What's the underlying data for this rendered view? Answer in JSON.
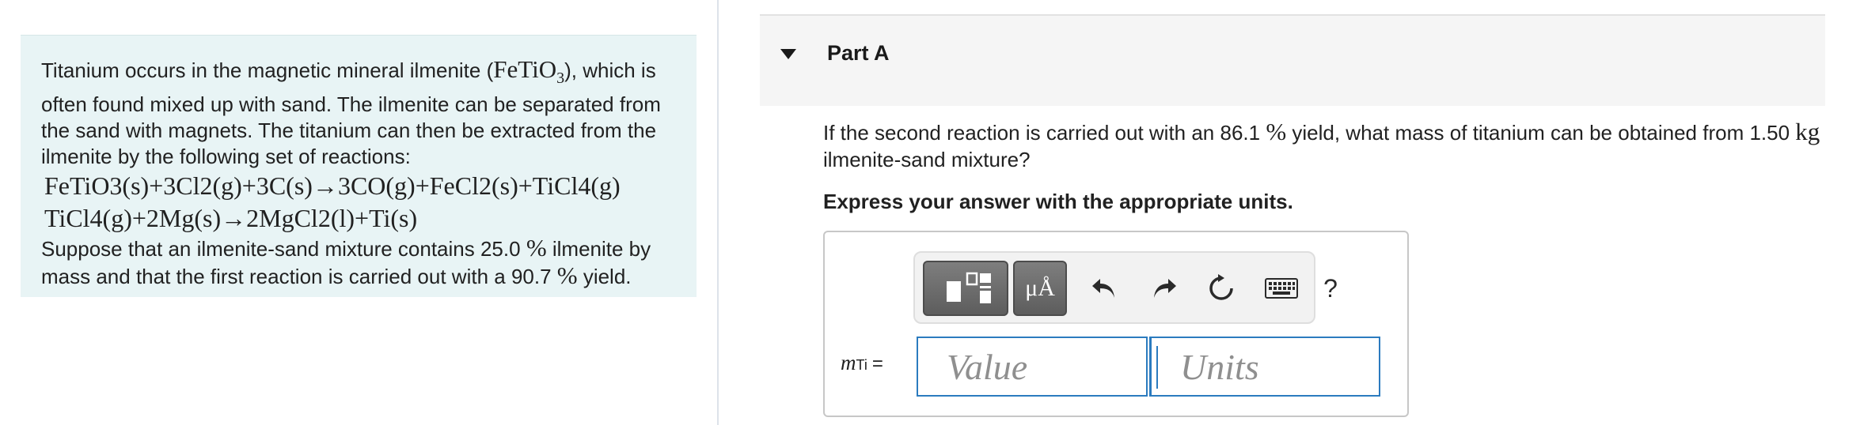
{
  "problem": {
    "intro_text": "Titanium occurs in the magnetic mineral ilmenite (",
    "intro_formula": "FeTiO",
    "intro_formula_sub": "3",
    "intro_text_2": "), which is often found mixed up with sand. The ilmenite can be separated from the sand with magnets. The titanium can then be extracted from the ilmenite by the following set of reactions:",
    "reaction_1": "FeTiO3(s)+3Cl2(g)+3C(s)→3CO(g)+FeCl2(s)+TiCl4(g)",
    "reaction_2": "TiCl4(g)+2Mg(s)→2MgCl2(l)+Ti(s)",
    "suppose_text_1": "Suppose that an ilmenite-sand mixture contains 25.0 ",
    "percent_symbol": "%",
    "suppose_text_2": " ilmenite by mass and that the first reaction is carried out with a 90.7 ",
    "suppose_text_3": " yield."
  },
  "part": {
    "title": "Part A",
    "question_1": "If the second reaction is carried out with an 86.1 ",
    "question_percent": "%",
    "question_2": " yield, what mass of titanium can be obtained from 1.50 ",
    "question_unit": "kg",
    "question_3": " ilmenite-sand mixture?",
    "instruction": "Express your answer with the appropriate units."
  },
  "answer": {
    "variable": "m",
    "variable_sub": "Ti",
    "equals": "=",
    "value_placeholder": "Value",
    "units_placeholder": "Units",
    "units_symbol_label": "μÅ",
    "help_label": "?"
  },
  "toolbar_icons": [
    "template-icon",
    "undo-icon",
    "redo-icon",
    "reset-icon",
    "keyboard-icon",
    "help-icon"
  ],
  "colors": {
    "panel_bg": "#e8f4f5",
    "input_border": "#2b7bbf",
    "header_bg": "#f5f5f5"
  }
}
